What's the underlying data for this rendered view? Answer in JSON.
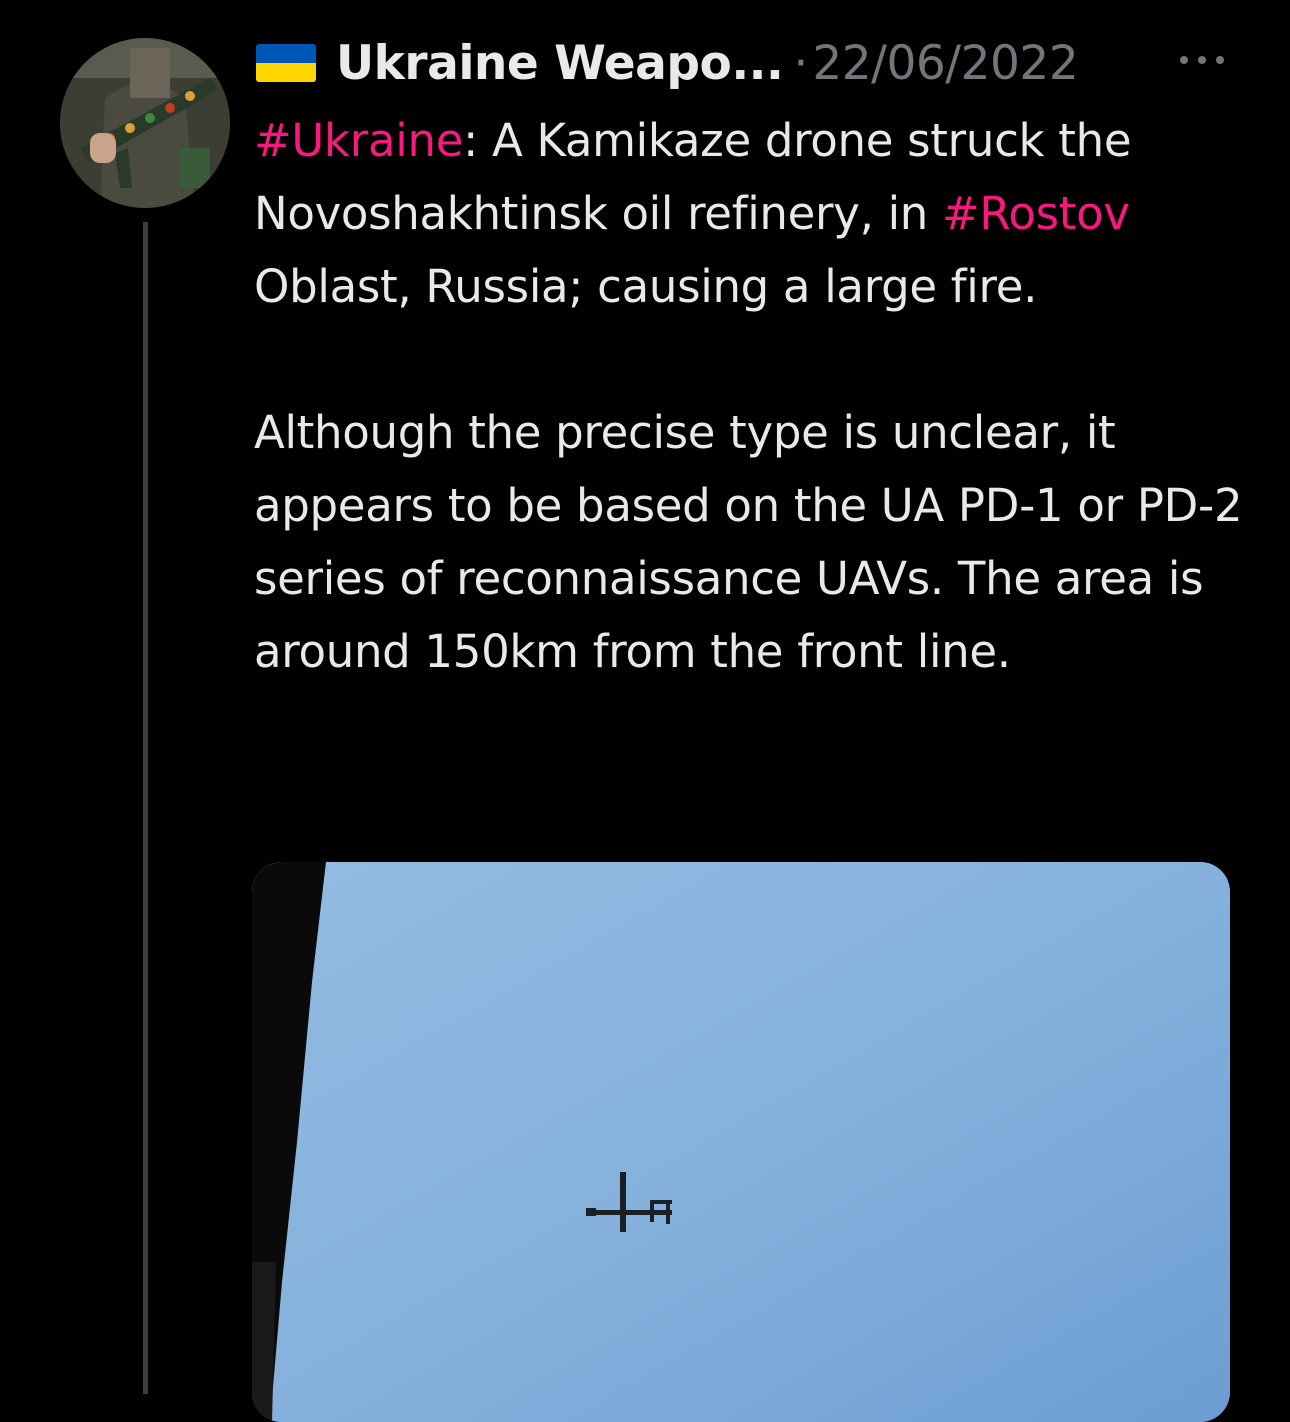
{
  "tweet": {
    "avatar_icon": "soldier-with-rifle-avatar",
    "flag_icon": "ukraine-flag-icon",
    "flag_colors": [
      "#0057b7",
      "#ffd700"
    ],
    "display_name": "Ukraine Weapo...",
    "separator": "·",
    "date": "22/06/2022",
    "more_icon": "more-options-icon",
    "paragraph1": {
      "hashtag1": "#Ukraine",
      "text1": ": A Kamikaze drone struck the Novoshakhtinsk oil refinery, in ",
      "hashtag2": "#Rostov",
      "text2": " Oblast, Russia; causing a large fire."
    },
    "paragraph2": "Although the precise type is unclear, it appears to be based on the UA PD-1 or PD-2 series of reconnaissance UAVs. The area is around 150km from the front line.",
    "media_icon": "drone-in-sky-photo",
    "hashtag_color": "#f91880",
    "text_color": "#e7e9ea",
    "muted_color": "#71767b"
  }
}
